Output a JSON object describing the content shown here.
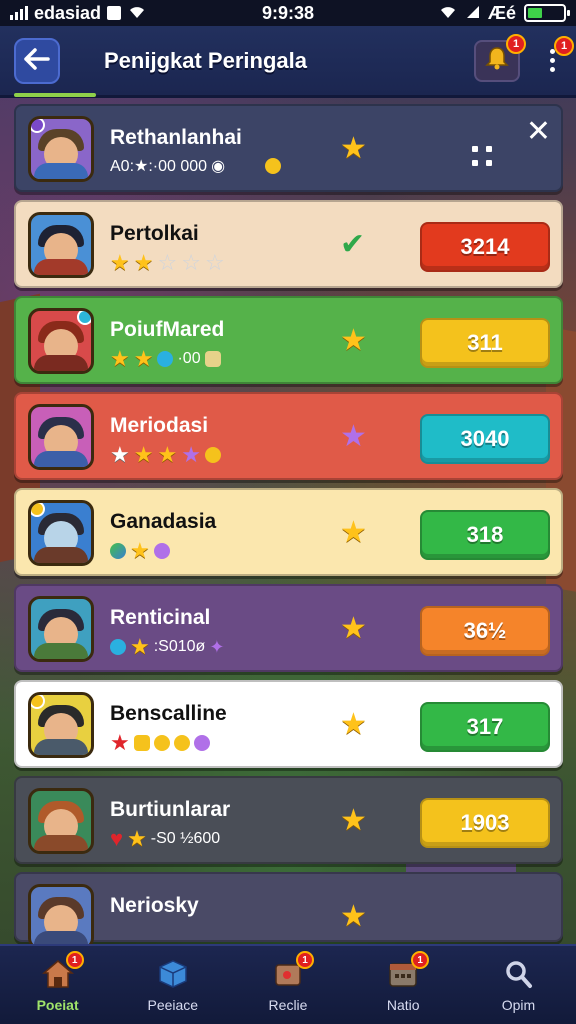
{
  "status": {
    "carrier": "edasiad",
    "time": "9:9:38",
    "indicators": "Æé"
  },
  "header": {
    "title": "Penijgkat Peringala",
    "notif_badge": "1",
    "more_badge": "1"
  },
  "players": [
    {
      "name": "Rethanlanhai",
      "sub": "A0:★:·00 000",
      "bg": "#3c4466",
      "score": null,
      "score_color": null,
      "mid_icon": "star-icon"
    },
    {
      "name": "Pertolkai",
      "sub": "",
      "bg": "#f3dcc0",
      "score": "3214",
      "score_color": "#e23a1e",
      "mid_icon": "check-icon"
    },
    {
      "name": "PoiufMared",
      "sub": "·00",
      "bg": "#55b24a",
      "score": "311",
      "score_color": "#f4c21c",
      "mid_icon": "star-icon"
    },
    {
      "name": "Meriodasi",
      "sub": "",
      "bg": "#e05a48",
      "score": "3040",
      "score_color": "#1fbcc8",
      "mid_icon": "star-purple-icon"
    },
    {
      "name": "Ganadasia",
      "sub": "",
      "bg": "#fbe7ae",
      "score": "318",
      "score_color": "#33b847",
      "mid_icon": "star-icon"
    },
    {
      "name": "Renticinal",
      "sub": ":S010ø",
      "bg": "#6a4b85",
      "score": "36½",
      "score_color": "#f5842a",
      "mid_icon": "star-icon"
    },
    {
      "name": "Benscalline",
      "sub": "",
      "bg": "#ffffff",
      "score": "317",
      "score_color": "#33b847",
      "mid_icon": "star-icon"
    },
    {
      "name": "Burtiunlarar",
      "sub": "-S0 ½600",
      "bg": "#4a4e57",
      "score": "1903",
      "score_color": "#f4c21c",
      "mid_icon": "star-icon"
    },
    {
      "name": "Neriosky",
      "sub": "",
      "bg": "#4a4a66",
      "score": null,
      "score_color": null,
      "mid_icon": "star-icon"
    }
  ],
  "tabs": [
    {
      "label": "Poeiat",
      "icon": "home-icon",
      "badge": "1",
      "active": true
    },
    {
      "label": "Peeiace",
      "icon": "cube-icon",
      "badge": "",
      "active": false
    },
    {
      "label": "Reclie",
      "icon": "scroll-icon",
      "badge": "1",
      "active": false
    },
    {
      "label": "Natio",
      "icon": "calendar-icon",
      "badge": "1",
      "active": false
    },
    {
      "label": "Opim",
      "icon": "search-icon",
      "badge": "",
      "active": false
    }
  ]
}
